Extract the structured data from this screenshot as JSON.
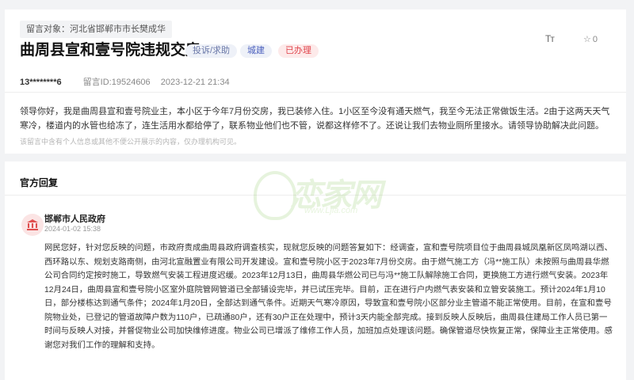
{
  "message": {
    "target_label": "留言对象：河北省邯郸市市长樊成华",
    "title": "曲周县宣和壹号院违规交房",
    "tags": {
      "type": "投诉/求助",
      "department": "城建",
      "status": "已办理"
    },
    "font_toggle": "Tт",
    "favorite_count": "0",
    "user": "13********6",
    "message_id": "留言ID:19524606",
    "timestamp": "2023-12-21 21:34",
    "content": "领导你好，我是曲周县宣和壹号院业主，本小区于今年7月份交房，我已装修入住。1小区至今没有通天燃气，我至今无法正常做饭生活。2由于这两天天气寒冷，楼道内的水管也给冻了，连生活用水都给停了，联系物业他们也不管，说都这样修不了。还说让我们去物业厕所里接水。请领导协助解决此问题。",
    "notice": "该留言中含有个人信息或其他不便公开展示的内容，仅办理机构可见。"
  },
  "reply": {
    "section_title": "官方回复",
    "watermark_text": "恋家网",
    "watermark_url": "www.Ljia.com",
    "org_name": "邯郸市人民政府",
    "date": "2024-01-02 15:38",
    "body": "网民您好，针对您反映的问题，市政府责成曲周县政府调查核实，现就您反映的问题答复如下：经调查，宣和壹号院项目位于曲周县城凤凰新区凤鸣湖以西、西环路以东、规划支路南侧，由河北宣融置业有限公司开发建设。宣和壹号院小区于2023年7月份交房。由于燃气施工方（冯**施工队）未按照与曲周县华燃公司合同约定按时施工，导致燃气安装工程进度迟缓。2023年12月13日，曲周县华燃公司已与冯**施工队解除施工合同，更换施工方进行燃气安装。2023年12月24日，曲周县宣和壹号院小区室外庭院管网管道已全部铺设完毕，并已试压完毕。目前，正在进行户内燃气表安装和立管安装施工。预计2024年1月10日，部分楼栋达到通气条件；2024年1月20日，全部达到通气条件。近期天气寒冷原因，导致宣和壹号院小区部分业主管道不能正常使用。目前，在宣和壹号院物业处，已登记的管道故障户数为110户，已疏通80户，还有30户正在处理中，预计3天内能全部完成。接到反映人反映后，曲周县住建局工作人员已第一时间与反映人对接，并督促物业公司加快维修进度。物业公司已增派了维修工作人员，加班加点处理该问题。确保管道尽快恢复正常，保障业主正常使用。感谢您对我们工作的理解和支持。"
  },
  "colors": {
    "page_bg": "#f2f3f5",
    "status_red": "#e0454c",
    "dept_blue": "#4a5fbd",
    "org_icon_red": "#e05050"
  }
}
